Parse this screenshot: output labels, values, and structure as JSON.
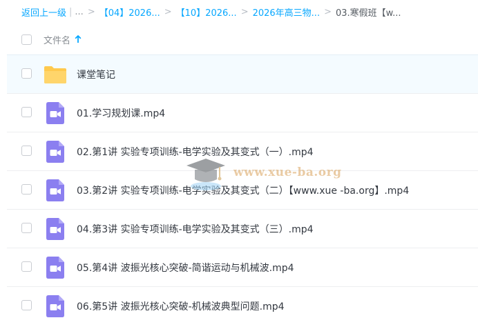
{
  "breadcrumb": {
    "back_label": "返回上一级",
    "pipe": "|",
    "ellipsis": "...",
    "separator": ">",
    "items": [
      {
        "label": "【04】2026..."
      },
      {
        "label": "【10】2026..."
      },
      {
        "label": "2026年高三物..."
      }
    ],
    "current": "03.寒假班【w..."
  },
  "header": {
    "column_label": "文件名",
    "sort_direction": "ascending"
  },
  "files": [
    {
      "name": "课堂笔记",
      "type": "folder",
      "icon": "folder-icon"
    },
    {
      "name": "01.学习规划课.mp4",
      "type": "video",
      "icon": "video-file-icon"
    },
    {
      "name": "02.第1讲 实验专项训练-电学实验及其变式（一）.mp4",
      "type": "video",
      "icon": "video-file-icon"
    },
    {
      "name": "03.第2讲 实验专项训练-电学实验及其变式（二）【www.xue -ba.org】.mp4",
      "type": "video",
      "icon": "video-file-icon"
    },
    {
      "name": "04.第3讲 实验专项训练-电学实验及其变式（三）.mp4",
      "type": "video",
      "icon": "video-file-icon"
    },
    {
      "name": "05.第4讲 波振光核心突破-简谐运动与机械波.mp4",
      "type": "video",
      "icon": "video-file-icon"
    },
    {
      "name": "06.第5讲 波振光核心突破-机械波典型问题.mp4",
      "type": "video",
      "icon": "video-file-icon"
    }
  ],
  "watermark": {
    "text": "www.xue-ba.org"
  },
  "colors": {
    "accent": "#06a7ff",
    "folder": "#ffd56b",
    "video": "#8b7ff0",
    "row_highlight": "#f4fbff"
  }
}
